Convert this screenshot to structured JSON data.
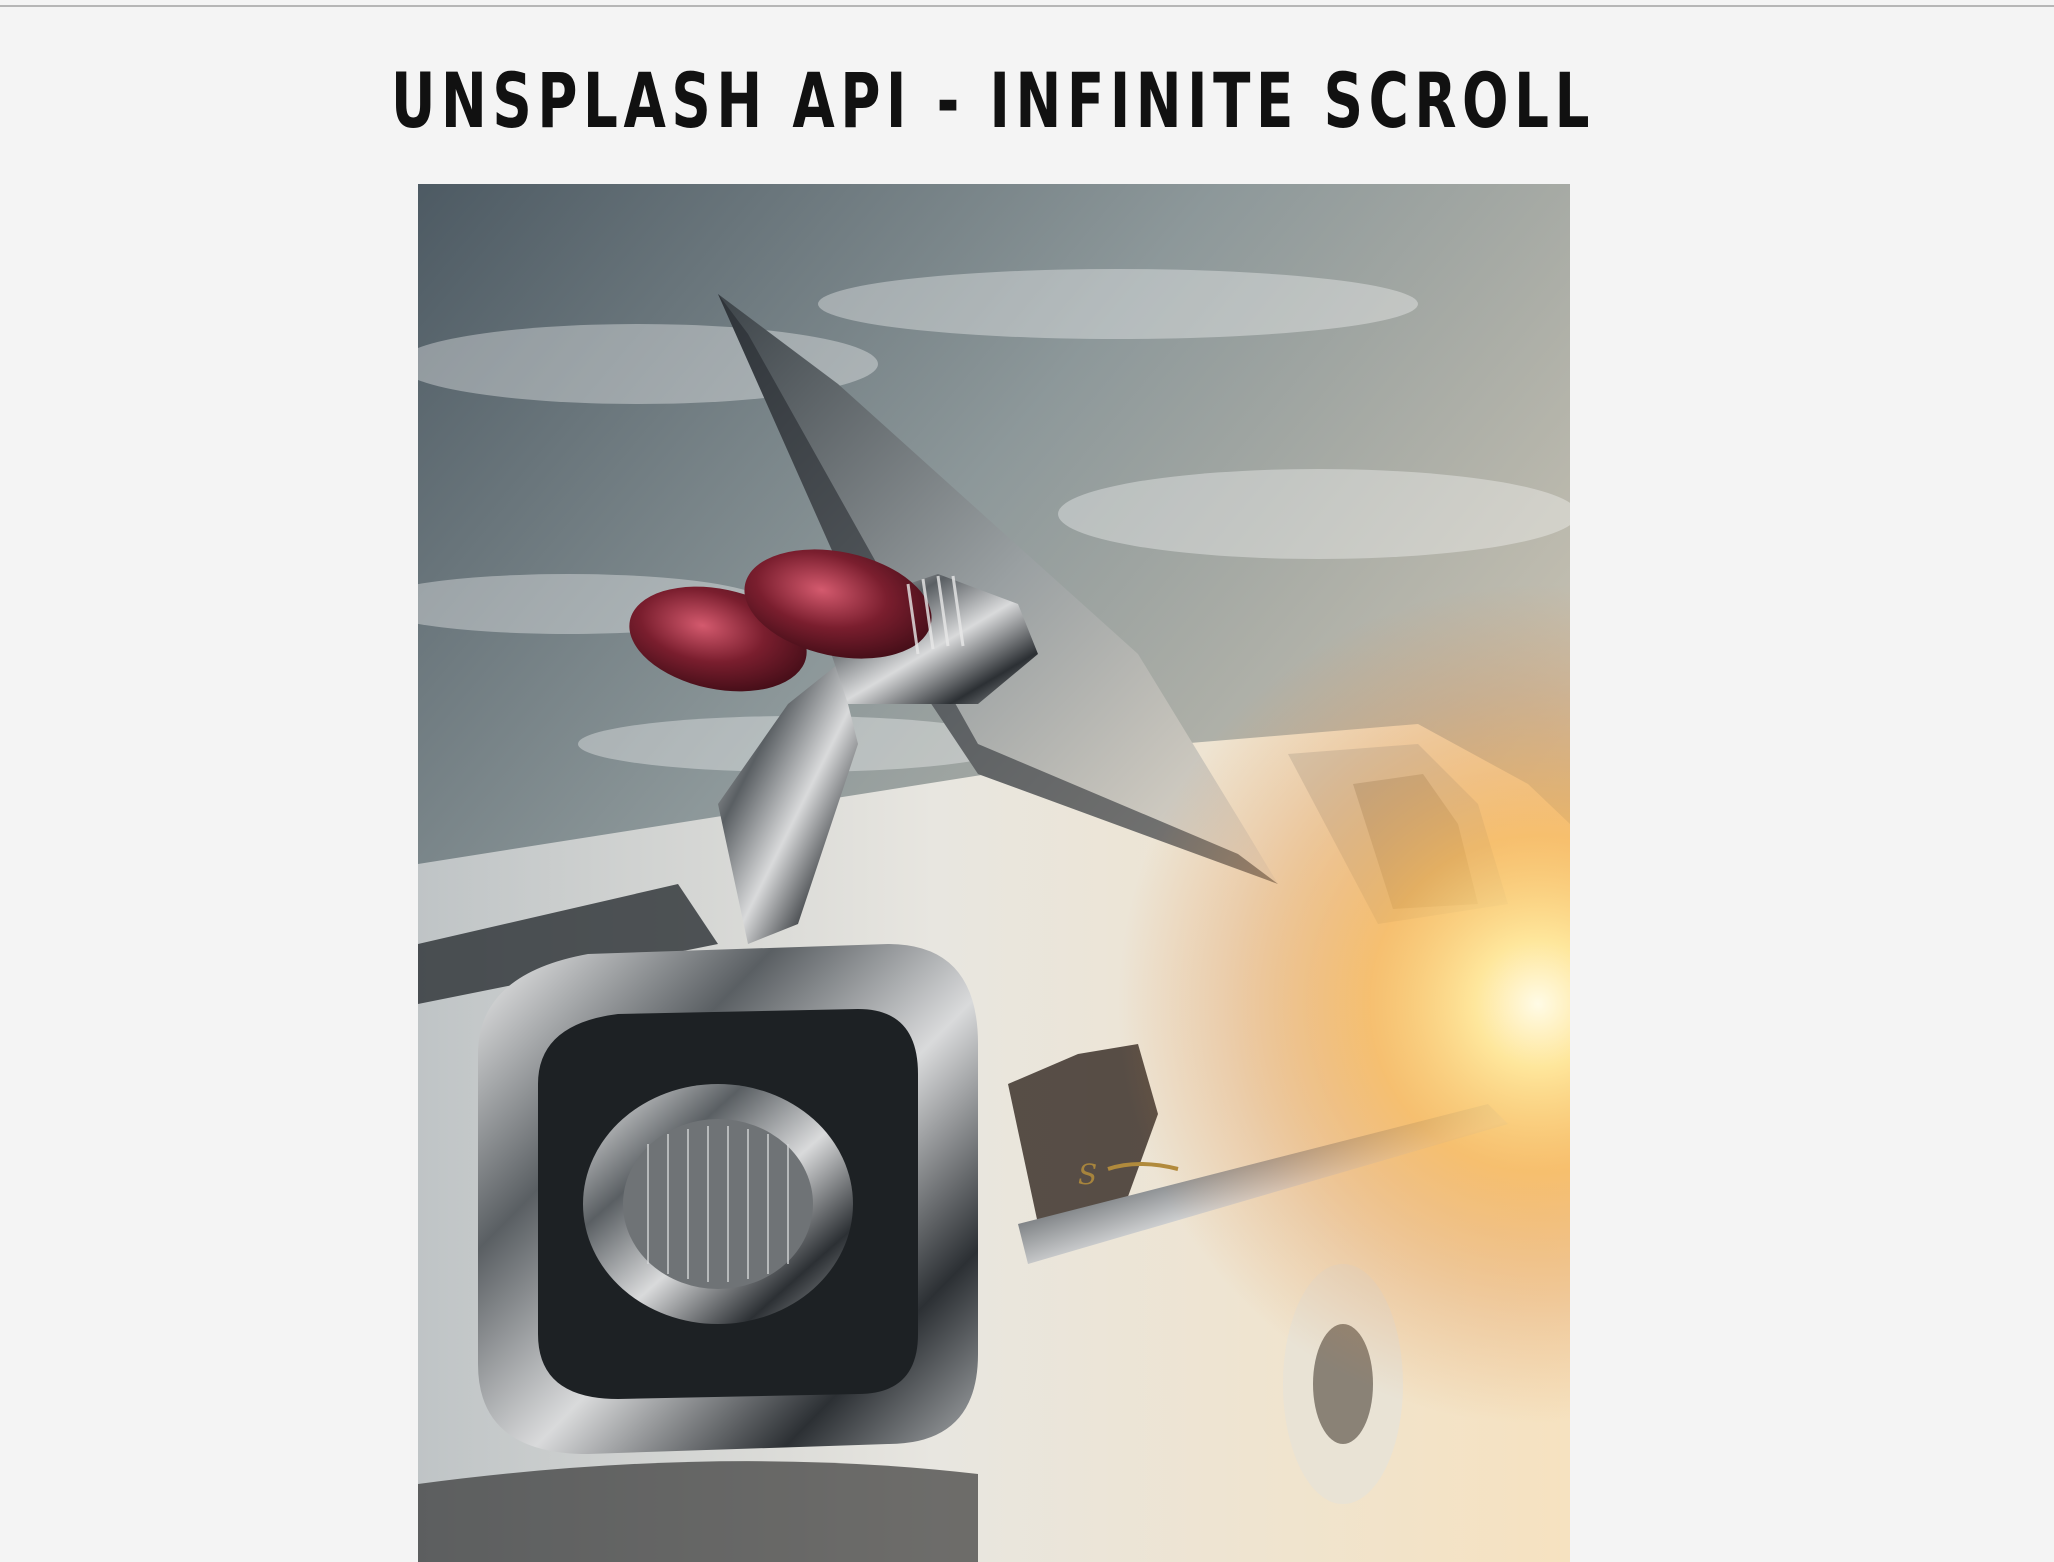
{
  "header": {
    "title": "UNSPLASH API - INFINITE SCROLL"
  },
  "gallery": {
    "images": [
      {
        "alt": "Classic car tail fin at sunset"
      }
    ]
  },
  "colors": {
    "background": "#f4f4f4",
    "title": "#111111",
    "divider": "#b6b6b6"
  }
}
